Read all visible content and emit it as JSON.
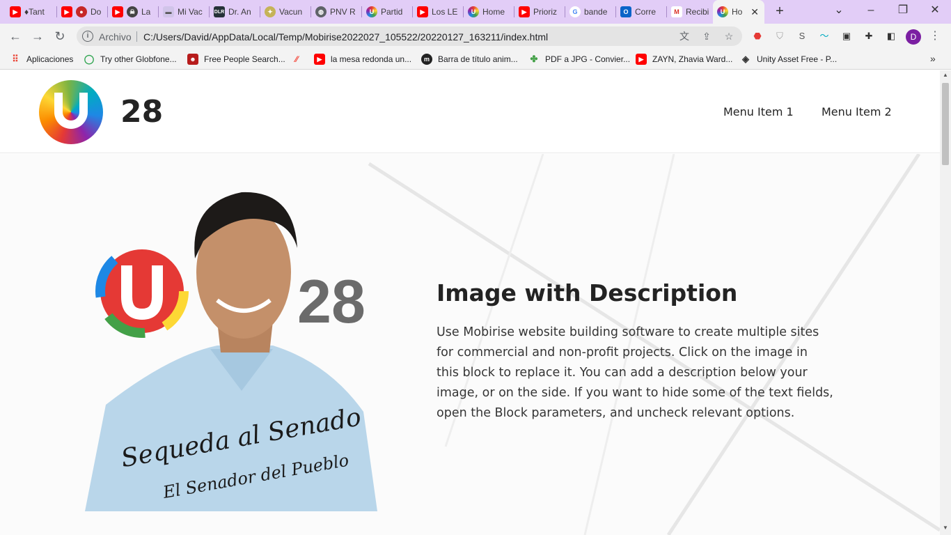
{
  "tabs": [
    {
      "label": "♦Tant",
      "icon": "youtube-icon"
    },
    {
      "label": "Do",
      "icon": "youtube-icon"
    },
    {
      "label": "La",
      "icon": "youtube-icon"
    },
    {
      "label": "Mi Vac",
      "icon": "page-icon"
    },
    {
      "label": "Dr. An",
      "icon": "dlr-icon"
    },
    {
      "label": "Vacun",
      "icon": "seal-icon"
    },
    {
      "label": "PNV R",
      "icon": "globe-icon"
    },
    {
      "label": "Partid",
      "icon": "u-logo-icon"
    },
    {
      "label": "Los LE",
      "icon": "youtube-icon"
    },
    {
      "label": "Home",
      "icon": "u-logo-icon"
    },
    {
      "label": "Prioriz",
      "icon": "youtube-icon"
    },
    {
      "label": "bande",
      "icon": "google-icon"
    },
    {
      "label": "Corre",
      "icon": "outlook-icon"
    },
    {
      "label": "Recibi",
      "icon": "gmail-icon"
    }
  ],
  "active_tab": {
    "label": "Ho",
    "icon": "u-logo-icon"
  },
  "address_bar": {
    "scheme_label": "Archivo",
    "url": "C:/Users/David/AppData/Local/Temp/Mobirise2022027_105522/20220127_163211/index.html"
  },
  "profile_initial": "D",
  "bookmarks": [
    {
      "label": "Aplicaciones",
      "icon": "apps-grid-icon"
    },
    {
      "label": "Try other Globfone...",
      "icon": "globfone-icon"
    },
    {
      "label": "Free People Search...",
      "icon": "people-search-icon"
    },
    {
      "label": "",
      "icon": "monday-icon"
    },
    {
      "label": "la mesa redonda un...",
      "icon": "youtube-icon"
    },
    {
      "label": "Barra de título anim...",
      "icon": "m-circle-icon"
    },
    {
      "label": "PDF a JPG - Convier...",
      "icon": "pdf-converter-icon"
    },
    {
      "label": "ZAYN, Zhavia Ward...",
      "icon": "youtube-icon"
    },
    {
      "label": "Unity Asset Free - P...",
      "icon": "unity-icon"
    }
  ],
  "site": {
    "brand": "28",
    "menu": [
      "Menu Item 1",
      "Menu Item 2"
    ]
  },
  "hero": {
    "image_caption_number": "28",
    "image_script_line1": "Sequeda al Senado",
    "image_script_line2": "El Senador del Pueblo",
    "title": "Image with Description",
    "text": "Use Mobirise website building software to create multiple sites for commercial and non-profit projects. Click on the image in this block to replace it. You can add a description below your image, or on the side. If you want to hide some of the text fields, open the Block parameters, and uncheck relevant options."
  },
  "colors": {
    "tab_strip": "#e2cdf7",
    "heading": "#232323",
    "body_text": "#353535",
    "profile": "#7b1fa2"
  }
}
